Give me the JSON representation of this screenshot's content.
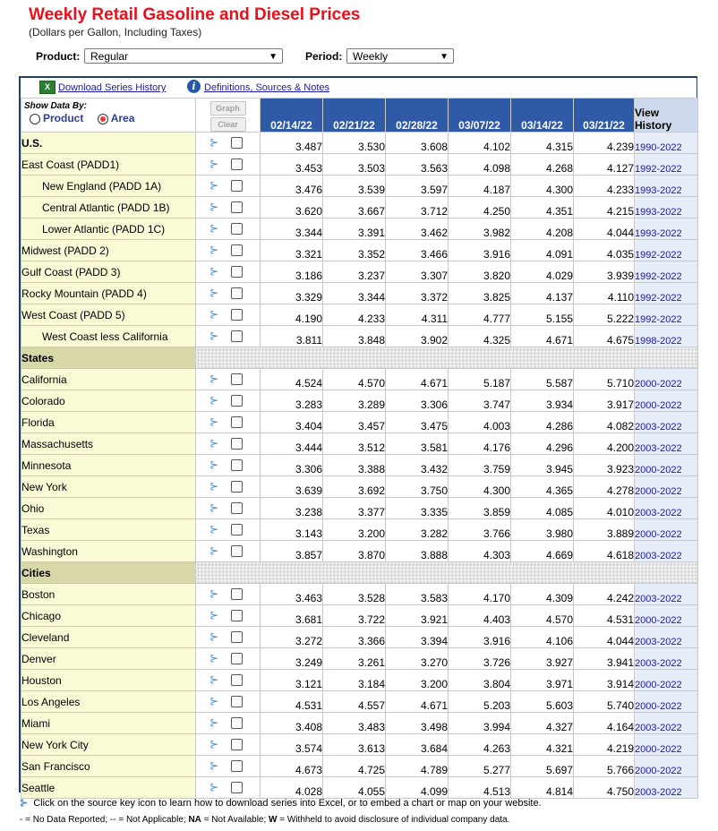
{
  "title": "Weekly Retail Gasoline and Diesel Prices",
  "subtitle": "(Dollars per Gallon, Including Taxes)",
  "product_label": "Product:",
  "product_value": "Regular",
  "period_label": "Period:",
  "period_value": "Weekly",
  "links": {
    "download": "Download Series History",
    "definitions": "Definitions, Sources & Notes"
  },
  "show_data_by": "Show Data By:",
  "radio_product": "Product",
  "radio_area": "Area",
  "radio_selected": "Area",
  "buttons": {
    "graph": "Graph",
    "clear": "Clear"
  },
  "dates": [
    "02/14/22",
    "02/21/22",
    "02/28/22",
    "03/07/22",
    "03/14/22",
    "03/21/22"
  ],
  "view_history_1": "View",
  "view_history_2": "History",
  "rows": [
    {
      "name": "U.S.",
      "style": "bold",
      "values": [
        "3.487",
        "3.530",
        "3.608",
        "4.102",
        "4.315",
        "4.239"
      ],
      "history": "1990-2022"
    },
    {
      "name": "East Coast (PADD1)",
      "style": "",
      "values": [
        "3.453",
        "3.503",
        "3.563",
        "4.098",
        "4.268",
        "4.127"
      ],
      "history": "1992-2022"
    },
    {
      "name": "New England (PADD 1A)",
      "style": "indent",
      "values": [
        "3.476",
        "3.539",
        "3.597",
        "4.187",
        "4.300",
        "4.233"
      ],
      "history": "1993-2022"
    },
    {
      "name": "Central Atlantic (PADD 1B)",
      "style": "indent",
      "values": [
        "3.620",
        "3.667",
        "3.712",
        "4.250",
        "4.351",
        "4.215"
      ],
      "history": "1993-2022"
    },
    {
      "name": "Lower Atlantic (PADD 1C)",
      "style": "indent",
      "values": [
        "3.344",
        "3.391",
        "3.462",
        "3.982",
        "4.208",
        "4.044"
      ],
      "history": "1993-2022"
    },
    {
      "name": "Midwest (PADD 2)",
      "style": "",
      "values": [
        "3.321",
        "3.352",
        "3.466",
        "3.916",
        "4.091",
        "4.035"
      ],
      "history": "1992-2022"
    },
    {
      "name": "Gulf Coast (PADD 3)",
      "style": "",
      "values": [
        "3.186",
        "3.237",
        "3.307",
        "3.820",
        "4.029",
        "3.939"
      ],
      "history": "1992-2022"
    },
    {
      "name": "Rocky Mountain (PADD 4)",
      "style": "",
      "values": [
        "3.329",
        "3.344",
        "3.372",
        "3.825",
        "4.137",
        "4.110"
      ],
      "history": "1992-2022"
    },
    {
      "name": "West Coast (PADD 5)",
      "style": "",
      "values": [
        "4.190",
        "4.233",
        "4.311",
        "4.777",
        "5.155",
        "5.222"
      ],
      "history": "1992-2022"
    },
    {
      "name": "West Coast less California",
      "style": "indent",
      "values": [
        "3.811",
        "3.848",
        "3.902",
        "4.325",
        "4.671",
        "4.675"
      ],
      "history": "1998-2022"
    },
    {
      "section": "States"
    },
    {
      "name": "California",
      "style": "",
      "values": [
        "4.524",
        "4.570",
        "4.671",
        "5.187",
        "5.587",
        "5.710"
      ],
      "history": "2000-2022"
    },
    {
      "name": "Colorado",
      "style": "",
      "values": [
        "3.283",
        "3.289",
        "3.306",
        "3.747",
        "3.934",
        "3.917"
      ],
      "history": "2000-2022"
    },
    {
      "name": "Florida",
      "style": "",
      "values": [
        "3.404",
        "3.457",
        "3.475",
        "4.003",
        "4.286",
        "4.082"
      ],
      "history": "2003-2022"
    },
    {
      "name": "Massachusetts",
      "style": "",
      "values": [
        "3.444",
        "3.512",
        "3.581",
        "4.176",
        "4.296",
        "4.200"
      ],
      "history": "2003-2022"
    },
    {
      "name": "Minnesota",
      "style": "",
      "values": [
        "3.306",
        "3.388",
        "3.432",
        "3.759",
        "3.945",
        "3.923"
      ],
      "history": "2000-2022"
    },
    {
      "name": "New York",
      "style": "",
      "values": [
        "3.639",
        "3.692",
        "3.750",
        "4.300",
        "4.365",
        "4.278"
      ],
      "history": "2000-2022"
    },
    {
      "name": "Ohio",
      "style": "",
      "values": [
        "3.238",
        "3.377",
        "3.335",
        "3.859",
        "4.085",
        "4.010"
      ],
      "history": "2003-2022"
    },
    {
      "name": "Texas",
      "style": "",
      "values": [
        "3.143",
        "3.200",
        "3.282",
        "3.766",
        "3.980",
        "3.889"
      ],
      "history": "2000-2022"
    },
    {
      "name": "Washington",
      "style": "",
      "values": [
        "3.857",
        "3.870",
        "3.888",
        "4.303",
        "4.669",
        "4.618"
      ],
      "history": "2003-2022"
    },
    {
      "section": "Cities"
    },
    {
      "name": "Boston",
      "style": "",
      "values": [
        "3.463",
        "3.528",
        "3.583",
        "4.170",
        "4.309",
        "4.242"
      ],
      "history": "2003-2022"
    },
    {
      "name": "Chicago",
      "style": "",
      "values": [
        "3.681",
        "3.722",
        "3.921",
        "4.403",
        "4.570",
        "4.531"
      ],
      "history": "2000-2022"
    },
    {
      "name": "Cleveland",
      "style": "",
      "values": [
        "3.272",
        "3.366",
        "3.394",
        "3.916",
        "4.106",
        "4.044"
      ],
      "history": "2003-2022"
    },
    {
      "name": "Denver",
      "style": "",
      "values": [
        "3.249",
        "3.261",
        "3.270",
        "3.726",
        "3.927",
        "3.941"
      ],
      "history": "2003-2022"
    },
    {
      "name": "Houston",
      "style": "",
      "values": [
        "3.121",
        "3.184",
        "3.200",
        "3.804",
        "3.971",
        "3.914"
      ],
      "history": "2000-2022"
    },
    {
      "name": "Los Angeles",
      "style": "",
      "values": [
        "4.531",
        "4.557",
        "4.671",
        "5.203",
        "5.603",
        "5.740"
      ],
      "history": "2000-2022"
    },
    {
      "name": "Miami",
      "style": "",
      "values": [
        "3.408",
        "3.483",
        "3.498",
        "3.994",
        "4.327",
        "4.164"
      ],
      "history": "2003-2022"
    },
    {
      "name": "New York City",
      "style": "",
      "values": [
        "3.574",
        "3.613",
        "3.684",
        "4.263",
        "4.321",
        "4.219"
      ],
      "history": "2000-2022"
    },
    {
      "name": "San Francisco",
      "style": "",
      "values": [
        "4.673",
        "4.725",
        "4.789",
        "5.277",
        "5.697",
        "5.766"
      ],
      "history": "2000-2022"
    },
    {
      "name": "Seattle",
      "style": "",
      "values": [
        "4.028",
        "4.055",
        "4.099",
        "4.513",
        "4.814",
        "4.750"
      ],
      "history": "2003-2022"
    }
  ],
  "footnote": "Click on the source key icon to learn how to download series into Excel, or to embed a chart or map on your website.",
  "legend": {
    "dash": "- = No Data Reported;",
    "ddash": "-- = Not Applicable;",
    "na_key": "NA",
    "na_text": "= Not Available;",
    "w_key": "W",
    "w_text": "= Withheld to avoid disclosure of individual company data."
  },
  "icons": {
    "source_key": "key-icon",
    "excel": "excel-icon",
    "info": "info-icon"
  },
  "colors": {
    "title": "#e8101a",
    "header_blue": "#2e5aa6",
    "name_bg": "#fafad7",
    "section_bg": "#d7d7a8",
    "history_bg": "#e6edf7"
  }
}
